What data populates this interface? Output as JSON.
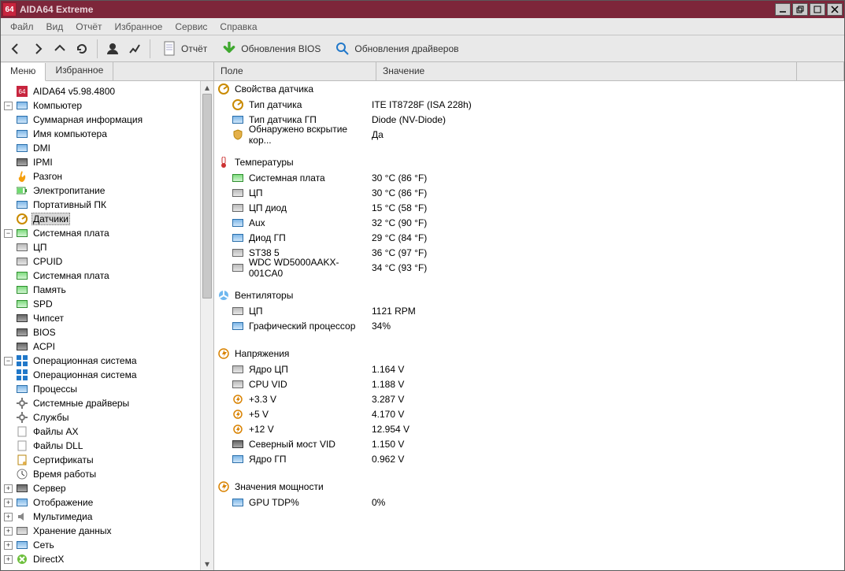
{
  "title": "AIDA64 Extreme",
  "menu": [
    "Файл",
    "Вид",
    "Отчёт",
    "Избранное",
    "Сервис",
    "Справка"
  ],
  "toolbar": {
    "report": "Отчёт",
    "bios": "Обновления BIOS",
    "drivers": "Обновления драйверов"
  },
  "left_tabs": {
    "menu": "Меню",
    "fav": "Избранное"
  },
  "tree_root": "AIDA64 v5.98.4800",
  "tree": {
    "computer": "Компьютер",
    "computer_children": [
      "Суммарная информация",
      "Имя компьютера",
      "DMI",
      "IPMI",
      "Разгон",
      "Электропитание",
      "Портативный ПК",
      "Датчики"
    ],
    "motherboard": "Системная плата",
    "motherboard_children": [
      "ЦП",
      "CPUID",
      "Системная плата",
      "Память",
      "SPD",
      "Чипсет",
      "BIOS",
      "ACPI"
    ],
    "os": "Операционная система",
    "os_children": [
      "Операционная система",
      "Процессы",
      "Системные драйверы",
      "Службы",
      "Файлы AX",
      "Файлы DLL",
      "Сертификаты",
      "Время работы"
    ],
    "server": "Сервер",
    "display": "Отображение",
    "multimedia": "Мультимедиа",
    "storage": "Хранение данных",
    "network": "Сеть",
    "directx": "DirectX"
  },
  "cols": {
    "field": "Поле",
    "value": "Значение"
  },
  "groups": {
    "sensor_props": "Свойства датчика",
    "temps": "Температуры",
    "fans": "Вентиляторы",
    "volts": "Напряжения",
    "power": "Значения мощности"
  },
  "sensor_props": [
    {
      "f": "Тип датчика",
      "v": "ITE IT8728F  (ISA 228h)"
    },
    {
      "f": "Тип датчика ГП",
      "v": "Diode  (NV-Diode)"
    },
    {
      "f": "Обнаружено вскрытие кор...",
      "v": "Да"
    }
  ],
  "temps": [
    {
      "f": "Системная плата",
      "v": "30 °C  (86 °F)"
    },
    {
      "f": "ЦП",
      "v": "30 °C  (86 °F)"
    },
    {
      "f": "ЦП диод",
      "v": "15 °C  (58 °F)"
    },
    {
      "f": "Aux",
      "v": "32 °C  (90 °F)"
    },
    {
      "f": "Диод ГП",
      "v": "29 °C  (84 °F)"
    },
    {
      "f": "ST38          5",
      "v": "36 °C  (97 °F)"
    },
    {
      "f": "WDC WD5000AAKX-001CA0",
      "v": "34 °C  (93 °F)"
    }
  ],
  "fans": [
    {
      "f": "ЦП",
      "v": "1121 RPM"
    },
    {
      "f": "Графический процессор",
      "v": "34%"
    }
  ],
  "volts": [
    {
      "f": "Ядро ЦП",
      "v": "1.164 V"
    },
    {
      "f": "CPU VID",
      "v": "1.188 V"
    },
    {
      "f": "+3.3 V",
      "v": "3.287 V"
    },
    {
      "f": "+5 V",
      "v": "4.170 V"
    },
    {
      "f": "+12 V",
      "v": "12.954 V"
    },
    {
      "f": "Северный мост VID",
      "v": "1.150 V"
    },
    {
      "f": "Ядро ГП",
      "v": "0.962 V"
    }
  ],
  "power": [
    {
      "f": "GPU TDP%",
      "v": "0%"
    }
  ]
}
